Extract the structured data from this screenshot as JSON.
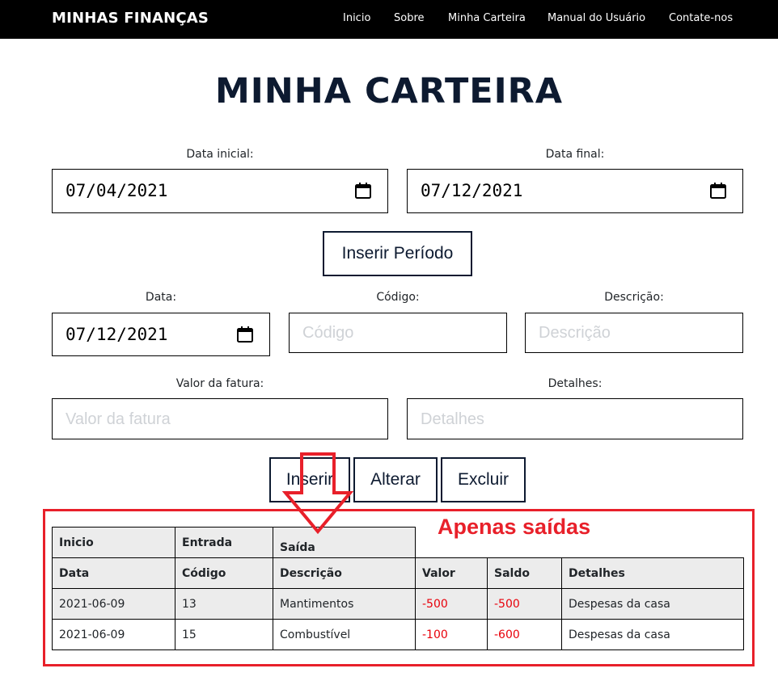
{
  "navbar": {
    "brand": "MINHAS FINANÇAS",
    "links": [
      "Inicio",
      "Sobre",
      "Minha Carteira",
      "Manual do Usuário",
      "Contate-nos"
    ]
  },
  "page_title": "MINHA CARTEIRA",
  "period": {
    "start_label": "Data inicial:",
    "start_value": "07/04/2021",
    "end_label": "Data final:",
    "end_value": "07/12/2021",
    "submit_label": "Inserir Período"
  },
  "entry": {
    "date_label": "Data:",
    "date_value": "07/12/2021",
    "code_label": "Código:",
    "code_placeholder": "Código",
    "desc_label": "Descrição:",
    "desc_placeholder": "Descrição",
    "amount_label": "Valor da fatura:",
    "amount_placeholder": "Valor da fatura",
    "details_label": "Detalhes:",
    "details_placeholder": "Detalhes"
  },
  "actions": {
    "insert_label": "Inserir",
    "update_label": "Alterar",
    "delete_label": "Excluir"
  },
  "table": {
    "group_headers": [
      "Inicio",
      "Entrada",
      "Saída"
    ],
    "headers": [
      "Data",
      "Código",
      "Descrição",
      "Valor",
      "Saldo",
      "Detalhes"
    ],
    "rows": [
      [
        "2021-06-09",
        "13",
        "Mantimentos",
        "-500",
        "-500",
        "Despesas da casa"
      ],
      [
        "2021-06-09",
        "15",
        "Combustível",
        "-100",
        "-600",
        "Despesas da casa"
      ]
    ]
  },
  "annotation": {
    "text": "Apenas saídas"
  },
  "colors": {
    "navbar_bg": "#000000",
    "title": "#0d1a30",
    "negative_value": "#e8000a",
    "annotation": "#e8202a"
  }
}
